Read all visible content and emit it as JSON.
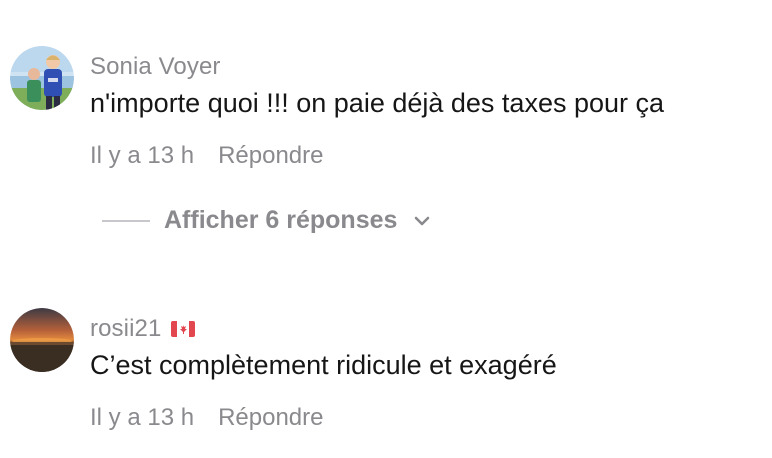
{
  "comments": [
    {
      "username": "Sonia Voyer",
      "avatar_icon": "user-avatar-photo-kids",
      "text": "n'importe quoi !!! on paie déjà des taxes pour ça",
      "time": "Il y a 13 h",
      "reply_label": "Répondre"
    },
    {
      "username": "rosii21",
      "avatar_icon": "user-avatar-photo-sunset",
      "flag_icon": "canada-flag-icon",
      "text": "C’est complètement ridicule et exagéré",
      "time": "Il y a 13 h",
      "reply_label": "Répondre"
    }
  ],
  "replies_toggle": {
    "label": "Afficher 6 réponses",
    "icon": "chevron-down-icon"
  },
  "colors": {
    "text_primary": "#161616",
    "text_secondary": "#8a8a8e",
    "divider": "#c7c7cc",
    "background": "#ffffff"
  }
}
